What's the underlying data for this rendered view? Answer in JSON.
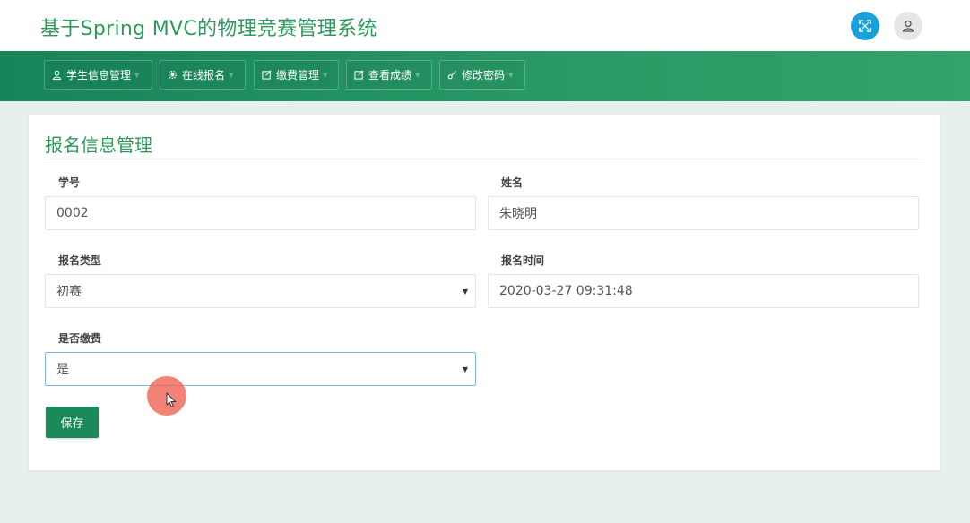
{
  "app": {
    "title": "基于Spring MVC的物理竞赛管理系统"
  },
  "header_icons": [
    "fullscreen-icon",
    "user-icon"
  ],
  "nav": {
    "items": [
      {
        "label": "学生信息管理",
        "icon": "user-icon"
      },
      {
        "label": "在线报名",
        "icon": "gear-icon"
      },
      {
        "label": "缴费管理",
        "icon": "edit-icon"
      },
      {
        "label": "查看成绩",
        "icon": "edit-icon"
      },
      {
        "label": "修改密码",
        "icon": "key-icon"
      }
    ]
  },
  "form": {
    "title": "报名信息管理",
    "student_id": {
      "label": "学号",
      "value": "0002"
    },
    "name": {
      "label": "姓名",
      "value": "朱晓明"
    },
    "enroll_type": {
      "label": "报名类型",
      "value": "初赛"
    },
    "enroll_time": {
      "label": "报名时间",
      "value": "2020-03-27 09:31:48"
    },
    "paid": {
      "label": "是否缴费",
      "value": "是"
    },
    "save_label": "保存"
  },
  "colors": {
    "brand_green": "#2e9a5f",
    "nav_green": "#17845a",
    "button_green": "#1b8a5a",
    "fullscreen_blue": "#1aa1dc",
    "page_bg": "#e8f0ee"
  }
}
